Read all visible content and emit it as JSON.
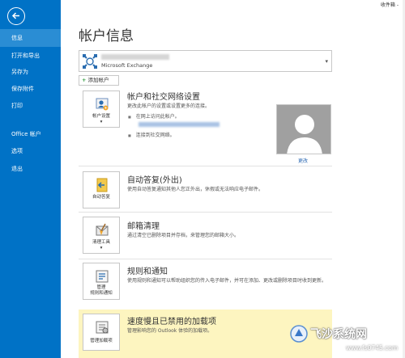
{
  "top_right": {
    "user": "收件箱 -"
  },
  "sidebar": {
    "items": [
      {
        "label": "信息",
        "active": true
      },
      {
        "label": "打开和导出"
      },
      {
        "label": "另存为"
      },
      {
        "label": "保存附件"
      },
      {
        "label": "打印"
      },
      {
        "label": "Office 帐户"
      },
      {
        "label": "选项"
      },
      {
        "label": "退出"
      }
    ]
  },
  "main": {
    "title": "帐户信息",
    "account": {
      "type": "Microsoft Exchange"
    },
    "add_account": "添加帐户",
    "sections": {
      "account_settings": {
        "tile_label": "帐户设置",
        "title": "帐户和社交网络设置",
        "desc": "更改此帐户的设置或设置更多的连接。",
        "bullet1": "在网上访问此帐户。",
        "bullet2": "连接到社交网络。"
      },
      "auto_reply": {
        "tile_label": "自动答复",
        "title": "自动答复(外出)",
        "desc": "使用自动答复通知其他人您正外出，休假或无法响应电子邮件。"
      },
      "mailbox_cleanup": {
        "tile_label": "清理工具",
        "title": "邮箱清理",
        "desc": "通过清空已删除项目并存档，来管理您的邮箱大小。"
      },
      "rules": {
        "tile_label_1": "管理",
        "tile_label_2": "规则和通知",
        "title": "规则和通知",
        "desc": "使用规则和通知可以帮助组织您的传入电子邮件，并可在添加、更改或删除项目时收到更新。"
      },
      "slow_addins": {
        "tile_label": "管理加载项",
        "title": "速度慢且已禁用的加载项",
        "desc": "管理影响您的 Outlook 体验的加载项。"
      }
    },
    "avatar_change": "更改"
  },
  "watermark": {
    "text": "飞沙系统网",
    "url": "www.fs0745.com"
  },
  "colors": {
    "sidebar": "#0072c6",
    "sidebar_active": "#2a8dd4",
    "highlight_band": "#fdf5c0",
    "link": "#2e6ab4"
  }
}
